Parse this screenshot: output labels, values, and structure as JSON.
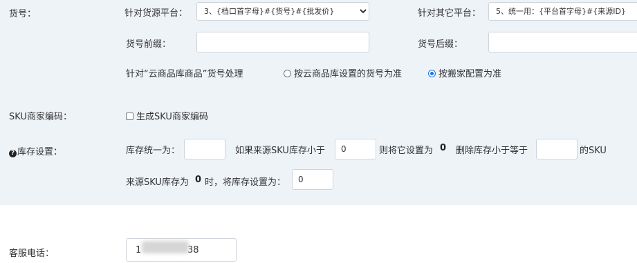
{
  "sku": {
    "label": "货号：",
    "source_platform_label": "针对货源平台：",
    "source_platform_selected": "3、{档口首字母}#{货号}#{批发价}",
    "other_platform_label": "针对其它平台：",
    "other_platform_selected": "5、统一用：{平台首字母}#{来源ID}",
    "prefix_label": "货号前缀：",
    "prefix_value": "",
    "suffix_label": "货号后缀：",
    "suffix_value": "",
    "cloud_label": "针对“云商品库商品”货号处理",
    "cloud_option_1": "按云商品库设置的货号为准",
    "cloud_option_2": "按搬家配置为准",
    "cloud_selected": 2
  },
  "sku_code": {
    "label": "SKU商家编码：",
    "checkbox_label": "生成SKU商家编码",
    "checked": false
  },
  "stock": {
    "label": "库存设置：",
    "help_icon": "question-circle-icon",
    "unify_label": "库存统一为：",
    "unify_value": "",
    "if_less_label": "如果来源SKU库存小于",
    "if_less_value": "0",
    "set_to_label": "则将它设置为",
    "set_to_value": "0",
    "delete_label": "删除库存小于等于",
    "delete_value": "",
    "delete_suffix": "的SKU",
    "zero_label_a": "来源SKU库存为",
    "zero_value": "0",
    "zero_label_b": "时，将库存设置为：",
    "zero_input": "0"
  },
  "service": {
    "label": "客服电话：",
    "phone_start": "1",
    "phone_end": "38"
  },
  "colors": {
    "panel_bg": "#eef3f8",
    "accent": "#1a73e8"
  }
}
